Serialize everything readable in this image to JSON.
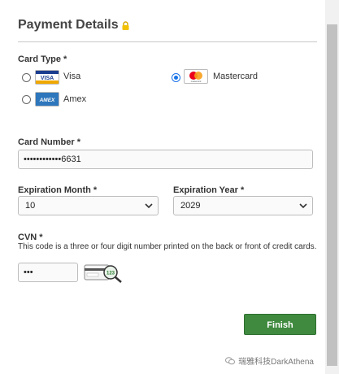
{
  "header": {
    "title": "Payment Details"
  },
  "card_type": {
    "label": "Card Type *",
    "options": [
      {
        "label": "Visa",
        "logo": "VISA",
        "selected": false
      },
      {
        "label": "Mastercard",
        "logo": "mastercard",
        "selected": true
      },
      {
        "label": "Amex",
        "logo": "AMEX",
        "selected": false
      }
    ]
  },
  "card_number": {
    "label": "Card Number *",
    "value": "••••••••••••6631"
  },
  "expiration_month": {
    "label": "Expiration Month *",
    "value": "10"
  },
  "expiration_year": {
    "label": "Expiration Year *",
    "value": "2029"
  },
  "cvn": {
    "label": "CVN *",
    "help": "This code is a three or four digit number printed on the back or front of credit cards.",
    "value": "•••",
    "icon_number": "123"
  },
  "actions": {
    "finish_label": "Finish"
  },
  "watermark": {
    "text": "瑞雅科技DarkAthena"
  },
  "colors": {
    "finish_bg": "#3f8a3f",
    "radio_selected": "#1a73e8"
  }
}
